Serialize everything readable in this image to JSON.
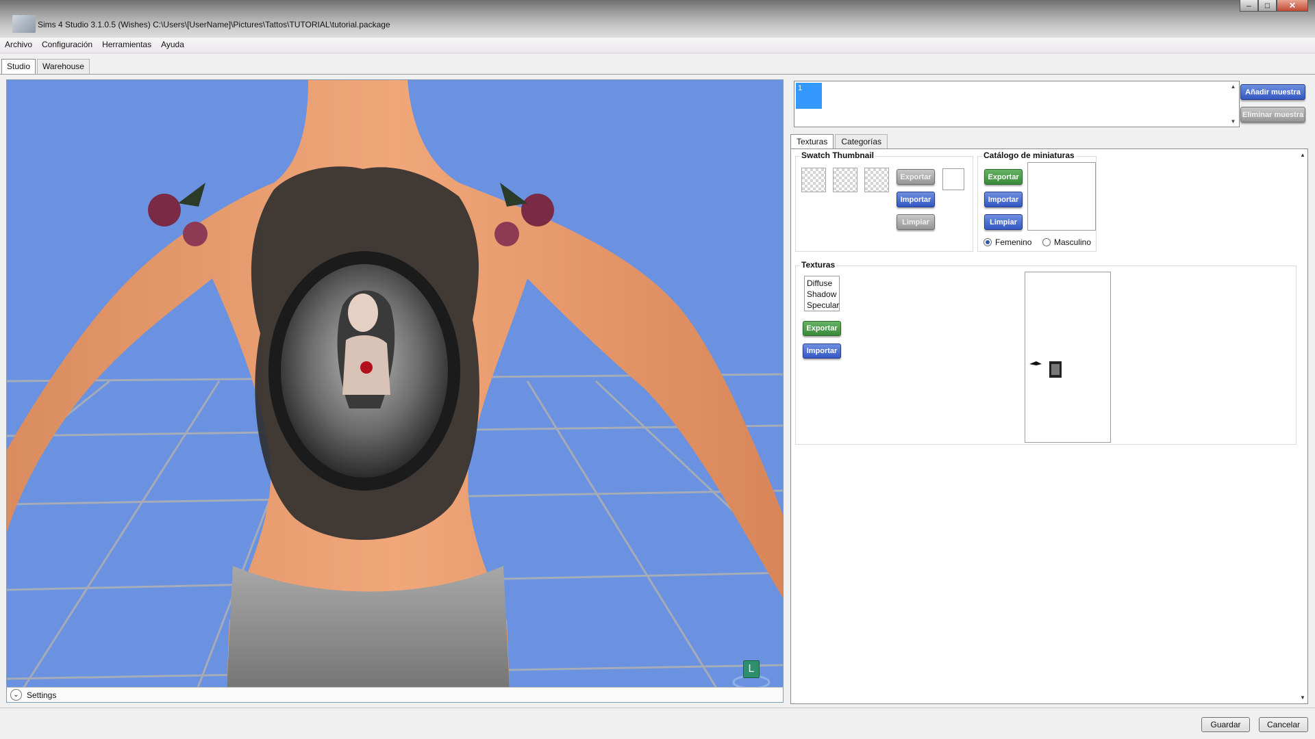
{
  "window": {
    "title": "Sims 4 Studio 3.1.0.5 (Wishes)  C:\\Users\\[UserName]\\Pictures\\Tattos\\TUTORIAL\\tutorial.package",
    "controls": {
      "minimize": "–",
      "maximize": "□",
      "close": "✕"
    }
  },
  "menu": [
    "Archivo",
    "Configuración",
    "Herramientas",
    "Ayuda"
  ],
  "top_tabs": [
    {
      "label": "Studio",
      "active": true
    },
    {
      "label": "Warehouse",
      "active": false
    }
  ],
  "viewport": {
    "settings_label": "Settings",
    "settings_toggle": "⌄",
    "camera_badge": "L",
    "background_color": "#6a92e0"
  },
  "swatches": {
    "items": [
      "1"
    ],
    "add_label": "Añadir muestra",
    "remove_label": "Eliminar muestra",
    "scroll_up": "▲",
    "scroll_down": "▼"
  },
  "inner_tabs": [
    {
      "label": "Texturas",
      "active": true
    },
    {
      "label": "Categorías",
      "active": false
    }
  ],
  "swatch_thumbnail": {
    "title": "Swatch Thumbnail",
    "export_label": "Exportar",
    "import_label": "Importar",
    "clear_label": "Limpiar"
  },
  "catalog": {
    "title": "Catálogo de miniaturas",
    "export_label": "Exportar",
    "import_label": "Importar",
    "clear_label": "Limpiar",
    "female_label": "Femenino",
    "male_label": "Masculino",
    "selected_gender": "Femenino"
  },
  "textures": {
    "title": "Texturas",
    "list": [
      "Diffuse",
      "Shadow",
      "Specular"
    ],
    "export_label": "Exportar",
    "import_label": "Importar"
  },
  "dialog": {
    "save_label": "Guardar",
    "cancel_label": "Cancelar"
  },
  "colors": {
    "accent_blue": "#3358c4",
    "accent_green": "#3b8a3b",
    "selection": "#3399ff"
  }
}
